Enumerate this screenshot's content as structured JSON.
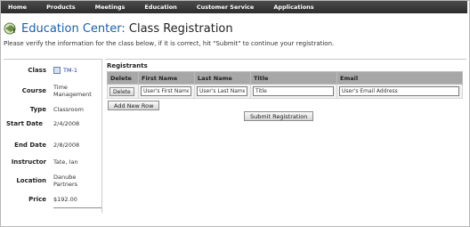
{
  "nav": {
    "items": [
      "Home",
      "Products",
      "Meetings",
      "Education",
      "Customer Service",
      "Applications"
    ]
  },
  "header": {
    "brand": "Education Center:",
    "title": " Class Registration",
    "instructions": "Please verify the information for the class below, if it is correct, hit \"Submit\" to continue your registration."
  },
  "class_info": {
    "class_label": "Class",
    "class_value": "TM-1",
    "course_label": "Course",
    "course_value": "Time Management",
    "type_label": "Type",
    "type_value": "Classroom",
    "start_label": "Start Date",
    "start_value": "2/4/2008",
    "end_label": "End Date",
    "end_value": "2/8/2008",
    "instructor_label": "Instructor",
    "instructor_value": "Tate, Ian",
    "location_label": "Location",
    "location_value": "Danube Partners",
    "price_label": "Price",
    "price_value": "$192.00"
  },
  "registrants": {
    "heading": "Registrants",
    "columns": [
      "Delete",
      "First Name",
      "Last Name",
      "Title",
      "Email"
    ],
    "row": {
      "delete_label": "Delete",
      "first_name": "User's First Name",
      "last_name": "User's Last Name",
      "title": "Title",
      "email": "User's Email Address"
    },
    "add_row_label": "Add New Row",
    "submit_label": "Submit Registration"
  },
  "colors": {
    "brand": "#1d5fa8",
    "nav_bg": "#3a3a3a",
    "table_header_bg": "#a7a7a7"
  }
}
